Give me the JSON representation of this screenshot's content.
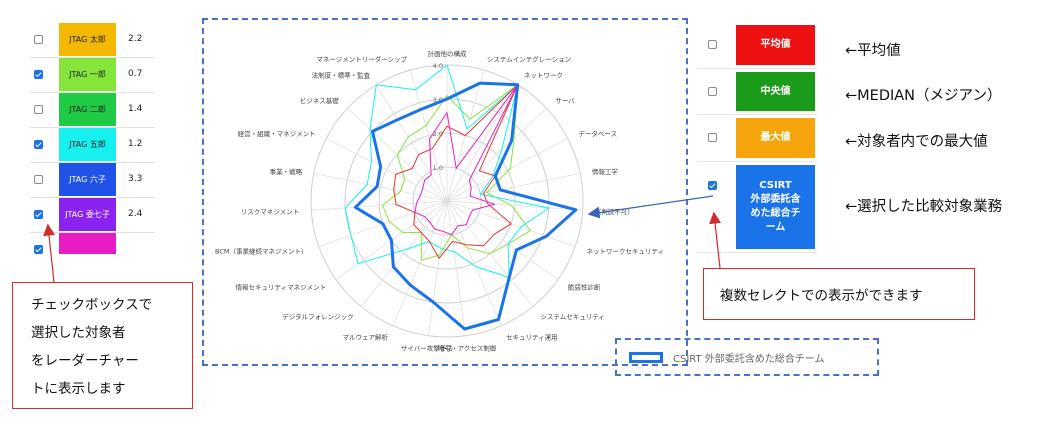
{
  "left_table": {
    "rows": [
      {
        "checked": false,
        "name": "JTAG 太郎",
        "score": "2.2",
        "color": "#f5b800",
        "text_color": "#222222"
      },
      {
        "checked": true,
        "name": "JTAG 一郎",
        "score": "0.7",
        "color": "#86e53a",
        "text_color": "#222222"
      },
      {
        "checked": false,
        "name": "JTAG 二郎",
        "score": "1.4",
        "color": "#1fcb45",
        "text_color": "#222222"
      },
      {
        "checked": true,
        "name": "JTAG 五郎",
        "score": "1.2",
        "color": "#16f1ef",
        "text_color": "#222222"
      },
      {
        "checked": false,
        "name": "JTAG 六子",
        "score": "3.3",
        "color": "#2152e8",
        "text_color": "#ffffff"
      },
      {
        "checked": true,
        "name": "JTAG 委七子",
        "score": "2.4",
        "color": "#8a22f0",
        "text_color": "#ffffff"
      },
      {
        "checked": true,
        "name": "",
        "score": "",
        "color": "#e91cc3",
        "text_color": "#ffffff"
      }
    ]
  },
  "chart_data": {
    "type": "radar",
    "axes": [
      "計画他の構成",
      "システムインテグレーション",
      "ネットワーク",
      "サーバ",
      "データベース",
      "情報工学",
      "（判読不可）",
      "ネットワークセキュリティ",
      "脆弱性診断",
      "システムセキュリティ",
      "セキュリティ運用",
      "暗号・アクセス制御",
      "サイバー攻撃手法",
      "マルウェア解析",
      "デジタルフォレンジック",
      "情報セキュリティマネジメント",
      "BCM（事業継続マネジメント）",
      "リスクマネジメント",
      "事業・戦略",
      "経営・組織・マネジメント",
      "ビジネス基礎",
      "法制度・標準・監査",
      "マネージメントリーダーシップ"
    ],
    "ticks": [
      "1.0",
      "2.0",
      "3.0",
      "4.0"
    ],
    "rlim": [
      0,
      4
    ],
    "grid": true,
    "series": [
      {
        "name": "CSIRT 外部委託含めた総合チーム",
        "color": "#1a73e8",
        "width": 3,
        "values": [
          3.0,
          3.6,
          4.0,
          2.6,
          1.6,
          1.6,
          3.8,
          3.1,
          2.5,
          2.9,
          3.8,
          3.8,
          3.0,
          2.7,
          2.5,
          2.0,
          2.0,
          2.7,
          2.1,
          2.2,
          3.0,
          2.8,
          2.8
        ]
      },
      {
        "name": "",
        "color": "#86e53a",
        "width": 1,
        "values": [
          3.1,
          2.5,
          4.0,
          2.7,
          2.1,
          1.2,
          1.9,
          2.6,
          2.2,
          2.0,
          1.5,
          1.0,
          1.6,
          1.9,
          1.2,
          1.6,
          1.8,
          1.9,
          1.4,
          1.4,
          2.0,
          2.2,
          2.3
        ]
      },
      {
        "name": "",
        "color": "#16f1ef",
        "width": 1,
        "values": [
          4.0,
          2.2,
          4.0,
          2.2,
          1.5,
          1.0,
          3.0,
          2.3,
          2.2,
          2.9,
          2.1,
          1.5,
          1.4,
          1.3,
          1.8,
          3.2,
          3.0,
          3.0,
          2.4,
          2.5,
          3.1,
          4.0,
          3.4
        ]
      },
      {
        "name": "",
        "color": "#e8332e",
        "width": 1,
        "values": [
          2.2,
          2.0,
          4.0,
          1.3,
          1.6,
          1.1,
          1.2,
          2.0,
          1.7,
          1.7,
          1.4,
          1.2,
          1.7,
          1.3,
          1.2,
          1.2,
          1.0,
          1.5,
          1.6,
          1.7,
          1.4,
          1.6,
          1.6
        ]
      },
      {
        "name": "",
        "color": "#e91cc3",
        "width": 1,
        "values": [
          2.6,
          1.0,
          4.0,
          0.9,
          0.8,
          0.7,
          1.4,
          0.8,
          0.8,
          0.9,
          0.8,
          1.0,
          0.9,
          0.9,
          0.8,
          0.8,
          1.0,
          0.9,
          0.8,
          0.8,
          0.9,
          0.9,
          1.9
        ]
      }
    ]
  },
  "legend": {
    "label": "CSIRT 外部委託含めた総合チーム"
  },
  "right_table": {
    "rows": [
      {
        "checked": false,
        "label": "平均値",
        "color": "#ee1111"
      },
      {
        "checked": false,
        "label": "中央値",
        "color": "#1a9c1a"
      },
      {
        "checked": false,
        "label": "最大値",
        "color": "#f5a50b"
      },
      {
        "checked": true,
        "label": "CSIRT\n外部委託含\nめた総合チ\nーム",
        "color": "#1a73e8"
      }
    ]
  },
  "notes": [
    "←平均値",
    "←MEDIAN（メジアン）",
    "←対象者内での最大値",
    "←選択した比較対象業務"
  ],
  "callouts": {
    "left_lines": [
      "チェックボックスで",
      "選択した対象者",
      "をレーダーチャー",
      "トに表示します"
    ],
    "right": "複数セレクトでの表示ができます"
  },
  "colors": {
    "arrow_red": "#d42b2b",
    "arrow_blue": "#3a62b8",
    "dashed_border": "#4a72c4"
  }
}
